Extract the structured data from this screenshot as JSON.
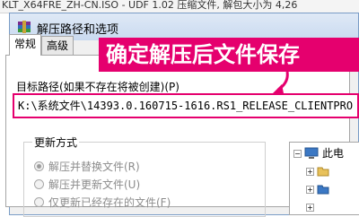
{
  "background_window": {
    "title": "KLT_X64FRE_ZH-CN.ISO - UDF 1.02 压缩文件, 解包大小为 4,26"
  },
  "dialog": {
    "title": "解压路径和选项",
    "tabs": [
      {
        "label": "常规",
        "active": true
      },
      {
        "label": "高级",
        "active": false
      }
    ],
    "path_label": "目标路径(如果不存在将被创建)(P)",
    "path_value": "K:\\系统文件\\14393.0.160715-1616.RS1_RELEASE_CLIENTPRO",
    "update_group": {
      "label": "更新方式",
      "options": [
        {
          "label": "解压并替换文件(R)",
          "selected": true,
          "enabled": false
        },
        {
          "label": "解压并更新文件(U)",
          "selected": false,
          "enabled": false
        },
        {
          "label": "仅更新已经存在的文件(F)",
          "selected": false,
          "enabled": false
        }
      ]
    },
    "tree": {
      "root_label": "此电"
    }
  },
  "annotation": {
    "text": "确定解压后文件保存"
  },
  "colors": {
    "accent": "#e5006e",
    "titlebar": "#c9daf0",
    "panel_bg": "#ffffff",
    "dialog_bg": "#f0f0f0"
  }
}
